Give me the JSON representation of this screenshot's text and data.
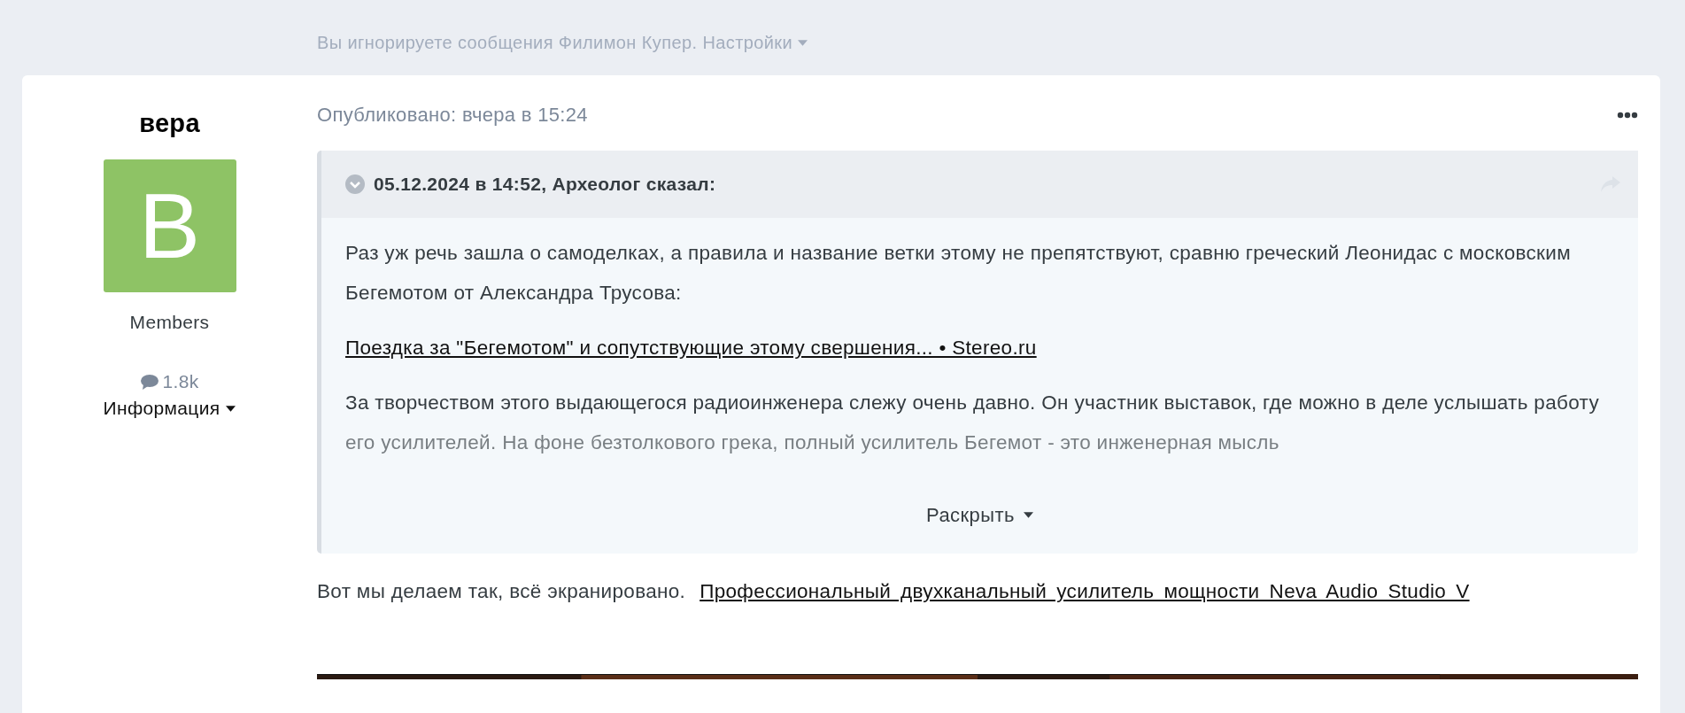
{
  "ignore_notice": {
    "text": "Вы игнорируете сообщения Филимон Купер.",
    "settings_link": "Настройки"
  },
  "author": {
    "name": "вера",
    "avatar_letter": "B",
    "group": "Members",
    "post_count": "1.8k",
    "info_link": "Информация"
  },
  "post": {
    "published": "Опубликовано: вчера в 15:24",
    "quote": {
      "header": "05.12.2024 в 14:52, Археолог сказал:",
      "paragraphs": [
        {
          "kind": "text",
          "text": "Раз уж речь зашла о самоделках, а правила и название ветки этому не препятствуют, сравню греческий Леонидас с московским Бегемотом от Александра Трусова:"
        },
        {
          "kind": "link",
          "text": "Поездка за \"Бегемотом\" и сопутствующие этому свершения... • Stereo.ru"
        },
        {
          "kind": "faded",
          "text": "За творчеством этого выдающегося радиоинженера слежу очень давно. Он участник выставок, где можно в деле услышать работу его усилителей. На фоне безтолкового грека, полный усилитель Бегемот - это инженерная мысль"
        }
      ],
      "expand": "Раскрыть"
    },
    "body_text": "Вот мы делаем так, всё экранировано.",
    "body_link": "Профессиональный двухканальный усилитель мощности Neva Audio Studio V"
  }
}
